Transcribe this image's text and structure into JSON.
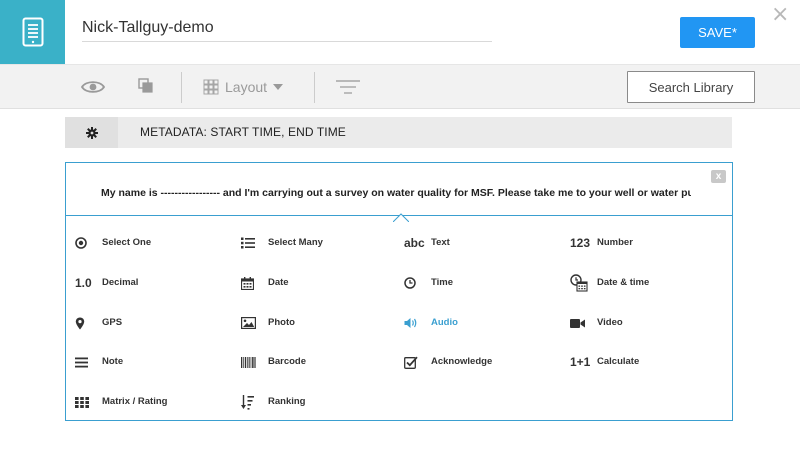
{
  "header": {
    "title_value": "Nick-Tallguy-demo",
    "save_label": "SAVE*",
    "close_glyph": "×"
  },
  "toolbar": {
    "layout_label": "Layout",
    "search_library_label": "Search Library"
  },
  "metadata": {
    "label": "METADATA:  START TIME, END TIME"
  },
  "question": {
    "text": "My name is ----------------- and I'm carrying out a survey on water quality for MSF. Please take me to your well or water pump",
    "close_glyph": "x"
  },
  "question_types": [
    {
      "label": "Select One",
      "icon": "radio-icon",
      "glyph": ""
    },
    {
      "label": "Select Many",
      "icon": "list-icon",
      "glyph": ""
    },
    {
      "label": "Text",
      "icon": "text-icon",
      "glyph": "abc"
    },
    {
      "label": "Number",
      "icon": "number-icon",
      "glyph": "123"
    },
    {
      "label": "Decimal",
      "icon": "decimal-icon",
      "glyph": "1.0"
    },
    {
      "label": "Date",
      "icon": "calendar-icon",
      "glyph": ""
    },
    {
      "label": "Time",
      "icon": "clock-icon",
      "glyph": ""
    },
    {
      "label": "Date & time",
      "icon": "datetime-icon",
      "glyph": ""
    },
    {
      "label": "GPS",
      "icon": "map-pin-icon",
      "glyph": ""
    },
    {
      "label": "Photo",
      "icon": "image-icon",
      "glyph": ""
    },
    {
      "label": "Audio",
      "icon": "volume-icon",
      "glyph": ""
    },
    {
      "label": "Video",
      "icon": "video-camera-icon",
      "glyph": ""
    },
    {
      "label": "Note",
      "icon": "note-lines-icon",
      "glyph": ""
    },
    {
      "label": "Barcode",
      "icon": "barcode-icon",
      "glyph": ""
    },
    {
      "label": "Acknowledge",
      "icon": "check-square-icon",
      "glyph": ""
    },
    {
      "label": "Calculate",
      "icon": "calculate-icon",
      "glyph": "1+1"
    },
    {
      "label": "Matrix / Rating",
      "icon": "grid-icon",
      "glyph": ""
    },
    {
      "label": "Ranking",
      "icon": "sort-icon",
      "glyph": ""
    }
  ],
  "colors": {
    "brand_teal": "#3ab1c8",
    "save_blue": "#2196f3",
    "accent_blue": "#3a9fd0"
  }
}
